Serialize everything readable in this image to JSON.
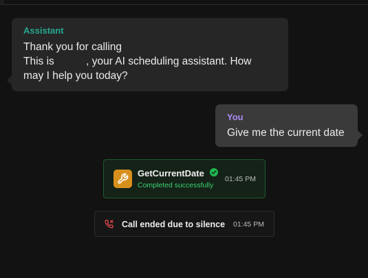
{
  "messages": {
    "assistant": {
      "sender": "Assistant",
      "text_part1": "Thank you for calling ",
      "text_part2": " This is ",
      "text_part3": ", your AI scheduling assistant. How may I help you today?"
    },
    "user": {
      "sender": "You",
      "text": "Give me the current date"
    }
  },
  "tool_call": {
    "name": "GetCurrentDate",
    "status": "Completed successfully",
    "time": "01:45 PM",
    "icon": "wrench-icon",
    "status_icon": "check-circle-icon"
  },
  "call_event": {
    "text": "Call ended due to silence",
    "time": "01:45 PM",
    "icon": "phone-missed-icon"
  },
  "colors": {
    "assistant_accent": "#26a88f",
    "user_accent": "#a98bf3",
    "tool_success": "#3bd16f",
    "tool_icon_bg": "#d8901c",
    "call_ended_icon": "#e5484d"
  }
}
